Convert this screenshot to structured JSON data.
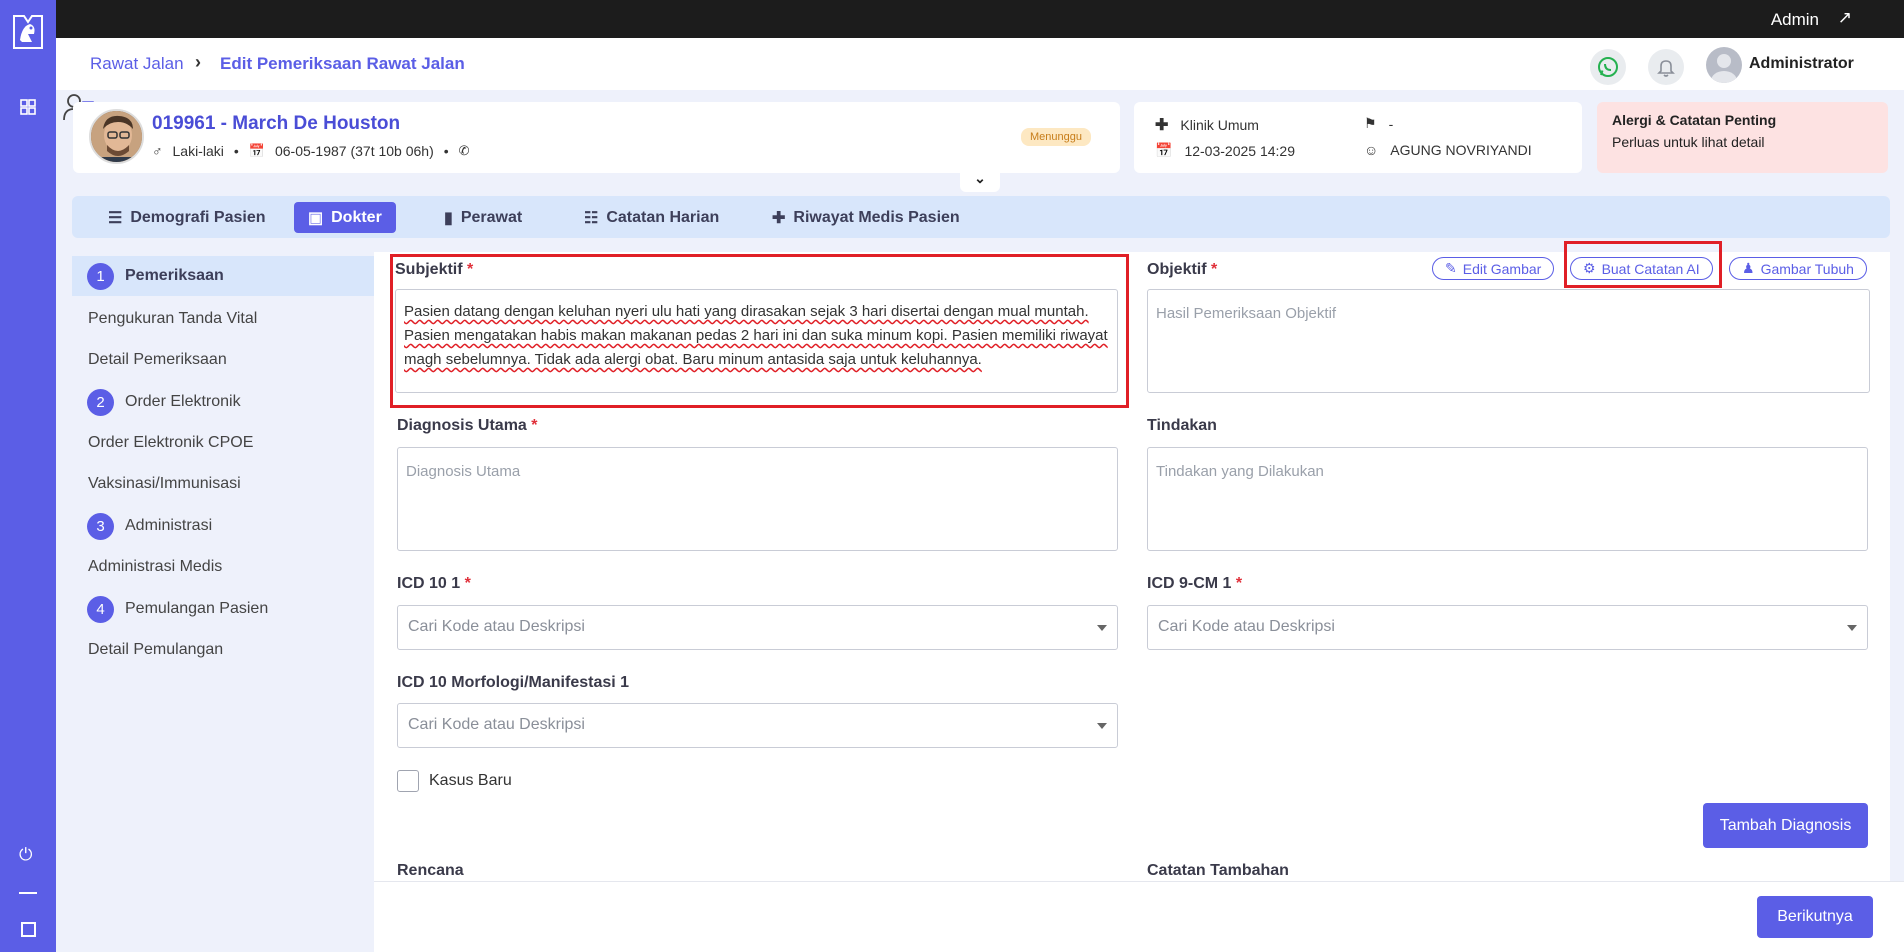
{
  "topbar": {
    "user_label": "Admin"
  },
  "breadcrumb": {
    "parent": "Rawat Jalan",
    "current": "Edit Pemeriksaan Rawat Jalan"
  },
  "header": {
    "user_name": "Administrator"
  },
  "patient": {
    "title": "019961 - March De Houston",
    "gender": "Laki-laki",
    "birth": "06-05-1987 (37t 10b 06h)",
    "status": "Menunggu"
  },
  "visit": {
    "clinic": "Klinik Umum",
    "datetime": "12-03-2025 14:29",
    "insurance": "-",
    "doctor": "AGUNG NOVRIYANDI"
  },
  "allergy": {
    "title": "Alergi & Catatan Penting",
    "subtitle": "Perluas untuk lihat detail"
  },
  "tabs": [
    {
      "label": "Demografi Pasien"
    },
    {
      "label": "Dokter"
    },
    {
      "label": "Perawat"
    },
    {
      "label": "Catatan Harian"
    },
    {
      "label": "Riwayat Medis Pasien"
    }
  ],
  "steps": [
    {
      "num": "1",
      "label": "Pemeriksaan"
    },
    {
      "num": "2",
      "label": "Order Elektronik"
    },
    {
      "num": "3",
      "label": "Administrasi"
    },
    {
      "num": "4",
      "label": "Pemulangan Pasien"
    }
  ],
  "substeps": {
    "s1a": "Pengukuran Tanda Vital",
    "s1b": "Detail Pemeriksaan",
    "s2a": "Order Elektronik CPOE",
    "s2b": "Vaksinasi/Immunisasi",
    "s3a": "Administrasi Medis",
    "s4a": "Detail Pemulangan"
  },
  "form": {
    "subjektif_label": "Subjektif",
    "subjektif_value": "Pasien datang dengan keluhan nyeri ulu hati yang dirasakan sejak 3 hari disertai dengan mual muntah. Pasien mengatakan habis makan makanan pedas 2 hari ini dan suka minum kopi. Pasien memiliki riwayat magh sebelumnya. Tidak ada alergi obat. Baru minum antasida saja untuk keluhannya.",
    "objektif_label": "Objektif",
    "objektif_placeholder": "Hasil Pemeriksaan Objektif",
    "edit_gambar": "Edit Gambar",
    "buat_catatan_ai": "Buat Catatan AI",
    "gambar_tubuh": "Gambar Tubuh",
    "diagnosis_label": "Diagnosis Utama",
    "diagnosis_placeholder": "Diagnosis Utama",
    "tindakan_label": "Tindakan",
    "tindakan_placeholder": "Tindakan yang Dilakukan",
    "icd10_label": "ICD 10 1",
    "icd9_label": "ICD 9-CM 1",
    "icd_morf_label": "ICD 10 Morfologi/Manifestasi 1",
    "select_placeholder": "Cari Kode atau Deskripsi",
    "kasus_baru": "Kasus Baru",
    "tambah_diagnosis": "Tambah Diagnosis",
    "rencana_label": "Rencana",
    "catatan_label": "Catatan Tambahan",
    "next_button": "Berikutnya"
  },
  "colors": {
    "primary": "#5b5ee6",
    "highlight": "#e01f26",
    "tab_bg": "#d8e6fb",
    "allergy_bg": "#fde2e2"
  }
}
